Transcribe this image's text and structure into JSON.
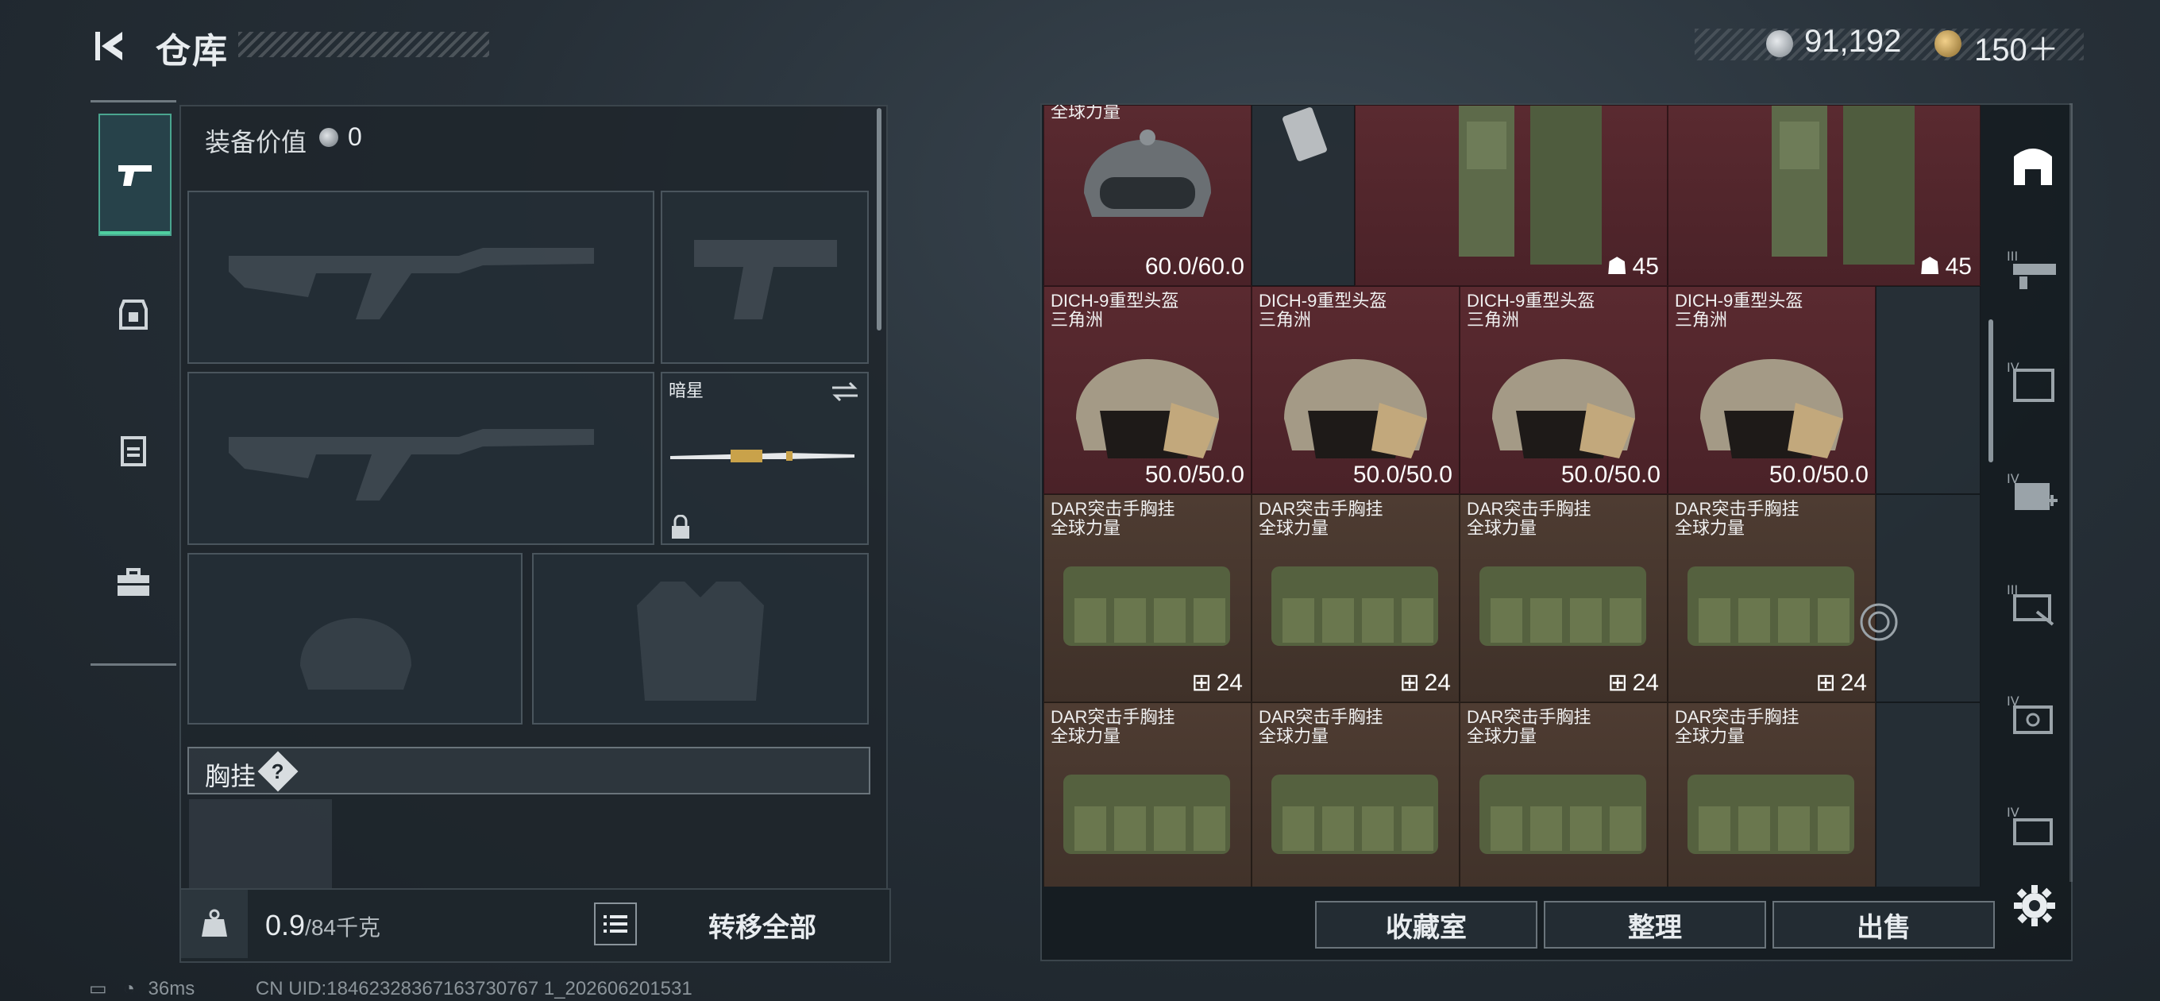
{
  "header": {
    "title": "仓库",
    "money": "91,192",
    "tokens": "150＋"
  },
  "loadout": {
    "equip_label": "装备价值",
    "equip_value": "0",
    "melee_name": "暗星",
    "chest_label": "胸挂",
    "chest_help": "?",
    "weight": "0.9",
    "weight_cap": "/84千克",
    "transfer_all": "转移全部"
  },
  "grid": {
    "top_row": [
      {
        "value": "60.0/60.0"
      },
      {
        "count": "45"
      },
      {
        "count": "45"
      }
    ],
    "partial_label": "全球力量",
    "helmets": [
      {
        "name": "DICH-9重型头盔",
        "faction": "三角洲",
        "durability": "50.0/50.0"
      },
      {
        "name": "DICH-9重型头盔",
        "faction": "三角洲",
        "durability": "50.0/50.0"
      },
      {
        "name": "DICH-9重型头盔",
        "faction": "三角洲",
        "durability": "50.0/50.0"
      },
      {
        "name": "DICH-9重型头盔",
        "faction": "三角洲",
        "durability": "50.0/50.0"
      }
    ],
    "rigs_row1": [
      {
        "name": "DAR突击手胸挂",
        "faction": "全球力量",
        "count": "24"
      },
      {
        "name": "DAR突击手胸挂",
        "faction": "全球力量",
        "count": "24"
      },
      {
        "name": "DAR突击手胸挂",
        "faction": "全球力量",
        "count": "24"
      },
      {
        "name": "DAR突击手胸挂",
        "faction": "全球力量",
        "count": "24"
      }
    ],
    "rigs_row2": [
      {
        "name": "DAR突击手胸挂",
        "faction": "全球力量"
      },
      {
        "name": "DAR突击手胸挂",
        "faction": "全球力量"
      },
      {
        "name": "DAR突击手胸挂",
        "faction": "全球力量"
      },
      {
        "name": "DAR突击手胸挂",
        "faction": "全球力量"
      }
    ]
  },
  "actions": {
    "collection": "收藏室",
    "sort": "整理",
    "sell": "出售"
  },
  "right_sidebar": {
    "tiers": [
      "III",
      "IV",
      "IV",
      "III",
      "IV",
      "IV"
    ]
  },
  "status": {
    "ping": "36ms",
    "uid": "CN UID:18462328367163730767 1_202606201531"
  },
  "colors": {
    "accent": "#4fcf9f",
    "red_cell": "#5a2a30",
    "brown_cell": "#4e3c32"
  }
}
